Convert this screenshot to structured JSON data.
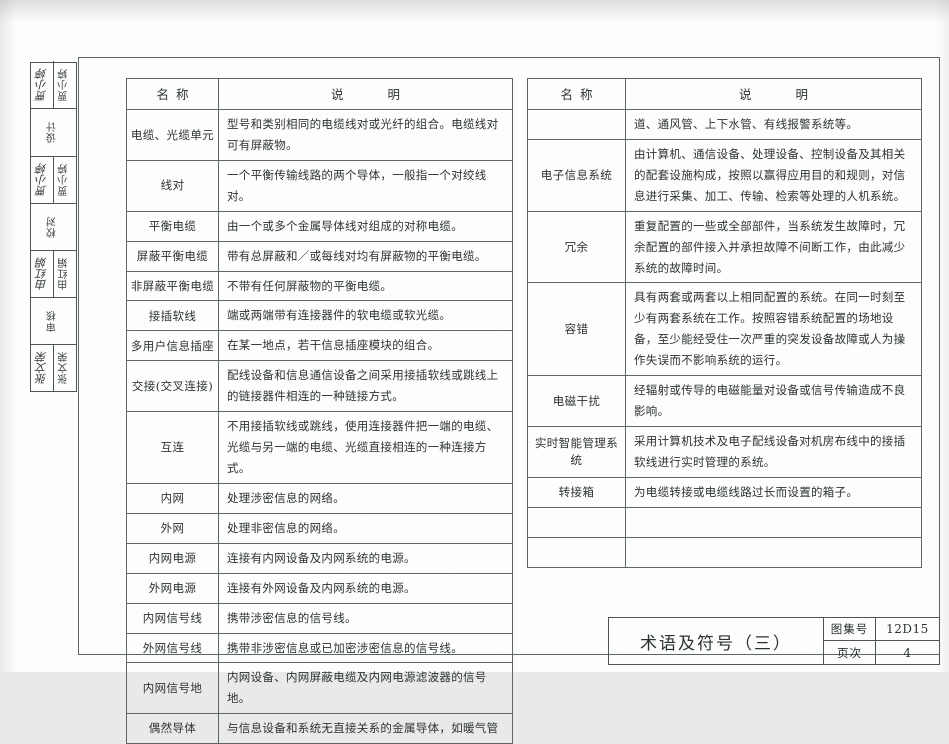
{
  "document": {
    "atlas_number_label": "图集号",
    "atlas_number_value": "12D15",
    "page_label": "页次",
    "page_value": "4",
    "sheet_title": "术语及符号（三）"
  },
  "signature_block": {
    "rows": [
      {
        "role": "张文荣",
        "signature": "张文荣"
      },
      {
        "role": "审核",
        "signature": ""
      },
      {
        "role": "由红娟",
        "signature": "由红娟"
      },
      {
        "role": "校对",
        "signature": ""
      },
      {
        "role": "贾小婷",
        "signature": "贾小婷"
      },
      {
        "role": "设计",
        "signature": ""
      },
      {
        "role": "贾小婷",
        "signature": "贾小婷"
      },
      {
        "role": "图籍",
        "signature": ""
      }
    ]
  },
  "left_table": {
    "header": {
      "name": "名称",
      "desc_left": "说",
      "desc_right": "明"
    },
    "rows": [
      {
        "name": "电缆、光缆单元",
        "desc": "型号和类别相同的电缆线对或光纤的组合。电缆线对可有屏蔽物。"
      },
      {
        "name": "线对",
        "desc": "一个平衡传输线路的两个导体，一般指一个对绞线对。"
      },
      {
        "name": "平衡电缆",
        "desc": "由一个或多个金属导体线对组成的对称电缆。"
      },
      {
        "name": "屏蔽平衡电缆",
        "desc": "带有总屏蔽和／或每线对均有屏蔽物的平衡电缆。"
      },
      {
        "name": "非屏蔽平衡电缆",
        "desc": "不带有任何屏蔽物的平衡电缆。"
      },
      {
        "name": "接插软线",
        "desc": "端或两端带有连接器件的软电缆或软光缆。"
      },
      {
        "name": "多用户信息插座",
        "desc": "在某一地点，若干信息插座模块的组合。"
      },
      {
        "name": "交接(交叉连接)",
        "desc": "配线设备和信息通信设备之间采用接插软线或跳线上的链接器件相连的一种链接方式。"
      },
      {
        "name": "互连",
        "desc": "不用接插软线或跳线，使用连接器件把一端的电缆、光缆与另一端的电缆、光缆直接相连的一种连接方式。"
      },
      {
        "name": "内网",
        "desc": "处理涉密信息的网络。"
      },
      {
        "name": "外网",
        "desc": "处理非密信息的网络。"
      },
      {
        "name": "内网电源",
        "desc": "连接有内网设备及内网系统的电源。"
      },
      {
        "name": "外网电源",
        "desc": "连接有外网设备及内网系统的电源。"
      },
      {
        "name": "内网信号线",
        "desc": "携带涉密信息的信号线。"
      },
      {
        "name": "外网信号线",
        "desc": "携带非涉密信息或已加密涉密信息的信号线。"
      },
      {
        "name": "内网信号地",
        "desc": "内网设备、内网屏蔽电缆及内网电源滤波器的信号地。"
      },
      {
        "name": "偶然导体",
        "desc": "与信息设备和系统无直接关系的金属导体，如暖气管"
      }
    ]
  },
  "right_table": {
    "header": {
      "name": "名称",
      "desc_left": "说",
      "desc_right": "明"
    },
    "rows": [
      {
        "name": "",
        "desc": "道、通风管、上下水管、有线报警系统等。"
      },
      {
        "name": "电子信息系统",
        "desc": "由计算机、通信设备、处理设备、控制设备及其相关的配套设施构成，按照以赢得应用目的和规则，对信息进行采集、加工、传输、检索等处理的人机系统。"
      },
      {
        "name": "冗余",
        "desc": "重复配置的一些或全部部件，当系统发生故障时，冗余配置的部件接入并承担故障不间断工作，由此减少系统的故障时间。"
      },
      {
        "name": "容错",
        "desc": "具有两套或两套以上相同配置的系统。在同一时刻至少有两套系统在工作。按照容错系统配置的场地设备，至少能经受住一次严重的突发设备故障或人为操作失误而不影响系统的运行。"
      },
      {
        "name": "电磁干扰",
        "desc": "经辐射或传导的电磁能量对设备或信号传输造成不良影响。"
      },
      {
        "name": "实时智能管理系统",
        "desc": "采用计算机技术及电子配线设备对机房布线中的接插软线进行实时管理的系统。"
      },
      {
        "name": "转接箱",
        "desc": "为电缆转接或电缆线路过长而设置的箱子。"
      },
      {
        "name": "",
        "desc": ""
      },
      {
        "name": "",
        "desc": ""
      }
    ]
  }
}
